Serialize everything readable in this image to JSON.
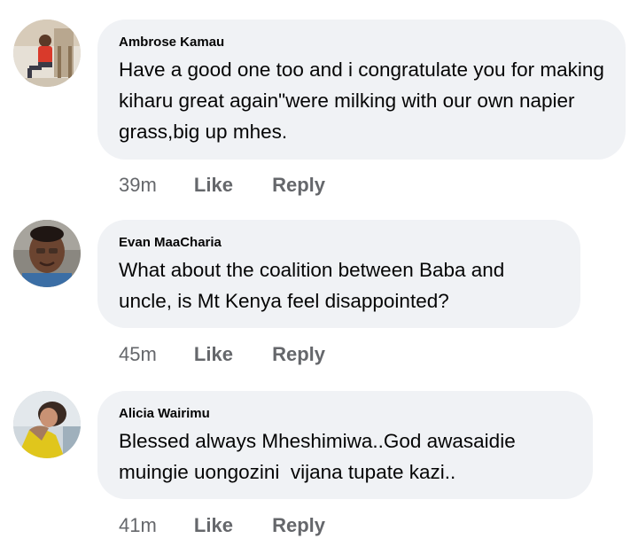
{
  "comments": [
    {
      "author": "Ambrose Kamau",
      "text": "Have a good one too and i congratulate you for making kiharu great again\"were milking with our own napier grass,big up mhes.",
      "time": "39m",
      "like_label": "Like",
      "reply_label": "Reply"
    },
    {
      "author": "Evan MaaCharia",
      "text": "What about the coalition between Baba and uncle, is Mt Kenya feel disappointed?",
      "time": "45m",
      "like_label": "Like",
      "reply_label": "Reply"
    },
    {
      "author": "Alicia Wairimu",
      "text": "Blessed always Mheshimiwa..God awasaidie muingie uongozini  vijana tupate kazi..",
      "time": "41m",
      "like_label": "Like",
      "reply_label": "Reply"
    }
  ]
}
